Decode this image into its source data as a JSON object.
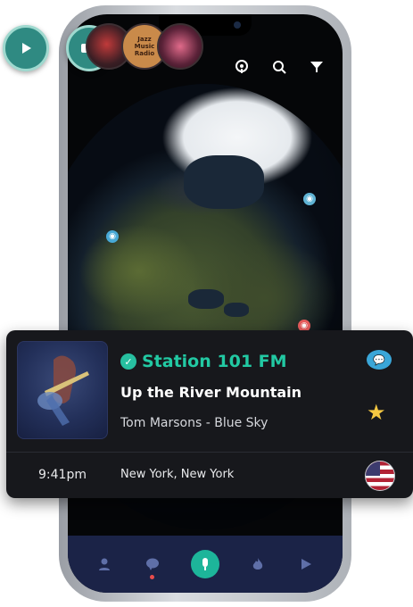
{
  "header": {
    "icons": [
      "podcast-icon",
      "search-icon",
      "filter-icon"
    ]
  },
  "floating_buttons": {
    "play": "play-icon",
    "video": "video-camera-icon"
  },
  "thumbnails": [
    {
      "name": "station-thumb-1"
    },
    {
      "name": "station-thumb-2",
      "label": "Jazz Music Radio"
    },
    {
      "name": "station-thumb-3"
    }
  ],
  "now_playing": {
    "station": "Station 101 FM",
    "song": "Up the River Mountain",
    "artist_album": "Tom Marsons - Blue Sky",
    "time": "9:41pm",
    "location": "New York, New York"
  },
  "colors": {
    "accent": "#22c9a3",
    "nav_bg": "#1b2347",
    "card_bg": "#17181c"
  },
  "bottom_nav": {
    "items": [
      "profile-icon",
      "chat-icon",
      "microphone-icon",
      "fire-icon",
      "play-icon"
    ]
  }
}
